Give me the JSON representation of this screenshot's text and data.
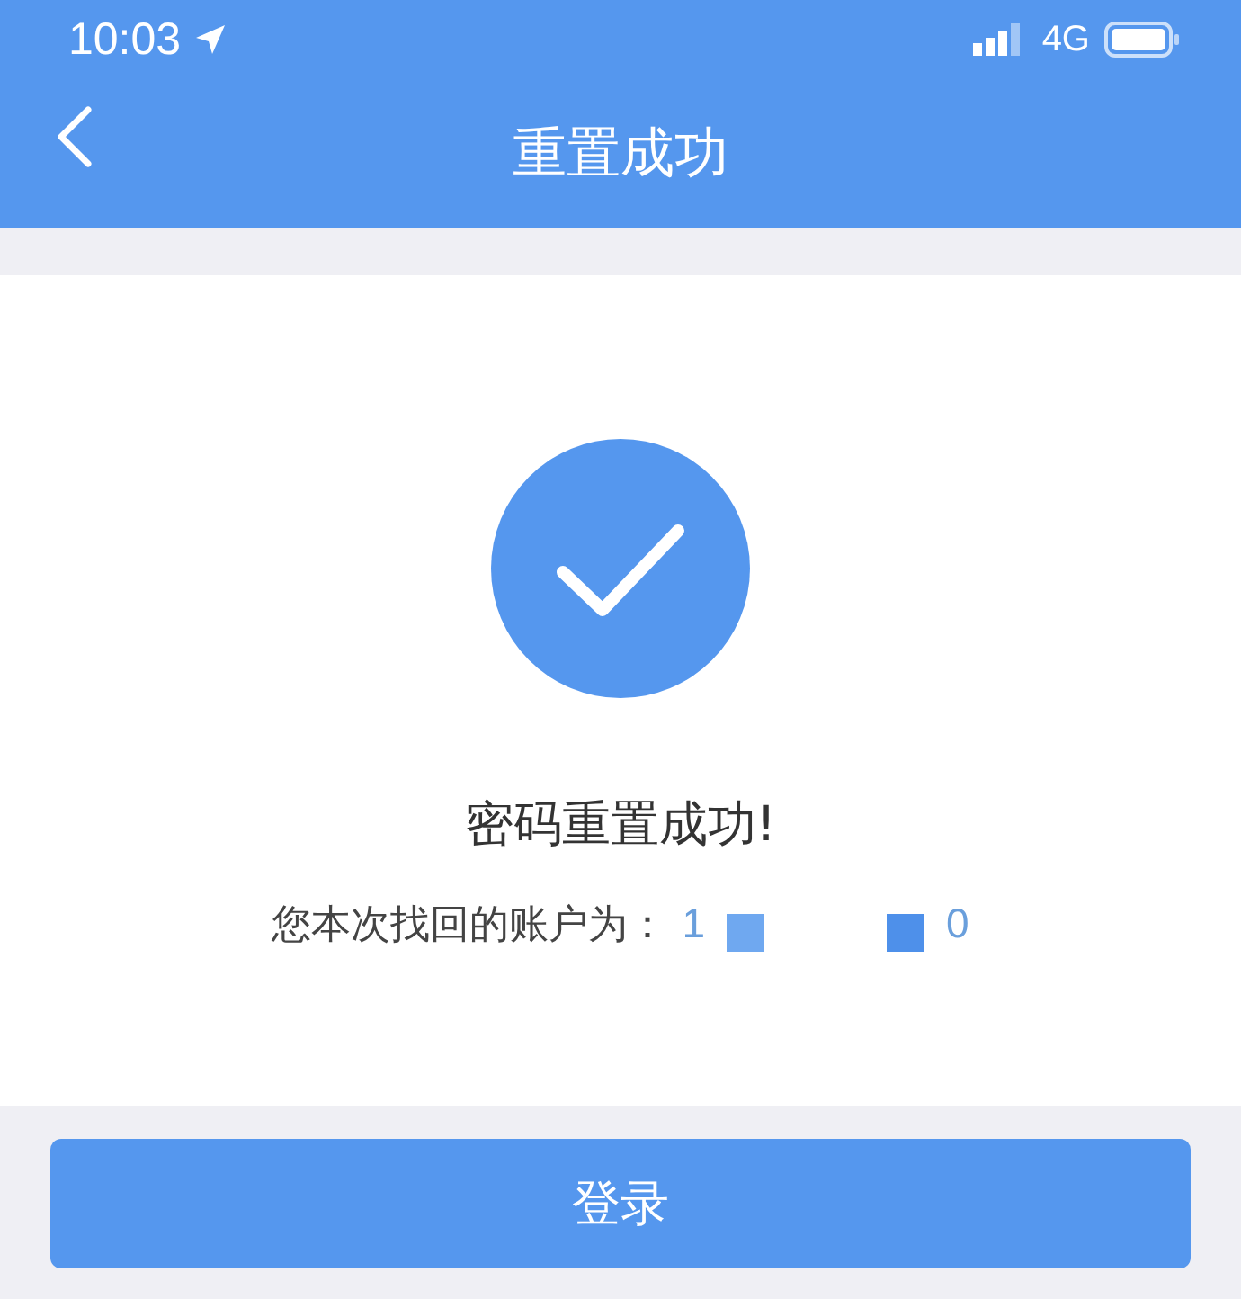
{
  "status_bar": {
    "time": "10:03",
    "network": "4G"
  },
  "nav_bar": {
    "title": "重置成功"
  },
  "result": {
    "message": "密码重置成功!",
    "account_label": "您本次找回的账户为：",
    "account_start": "1",
    "account_end": "0"
  },
  "login_button": "登录"
}
